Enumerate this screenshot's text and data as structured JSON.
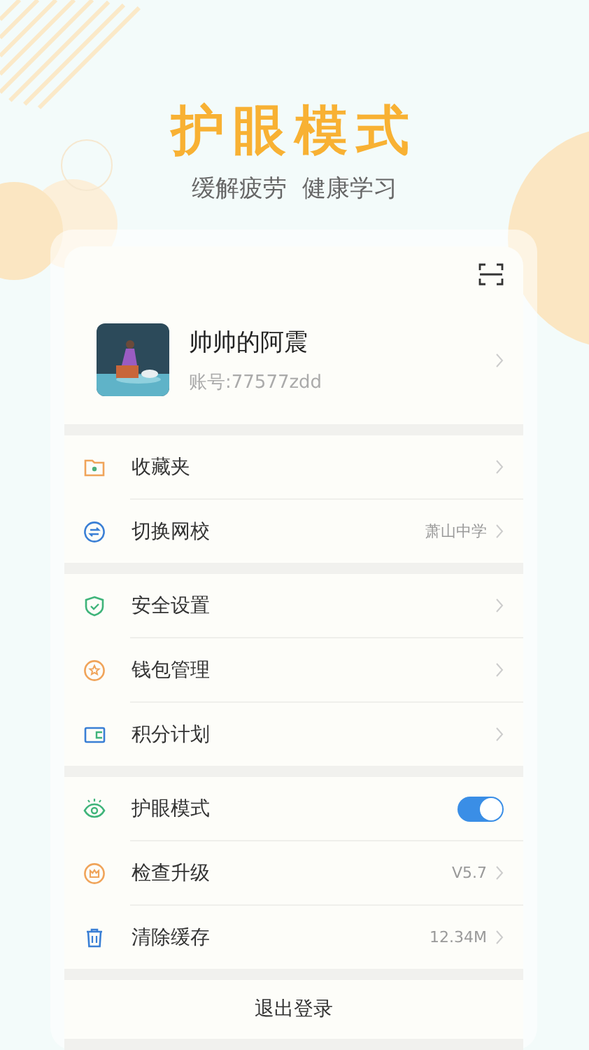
{
  "header": {
    "title": "护眼模式",
    "subtitle": "缓解疲劳  健康学习"
  },
  "profile": {
    "name": "帅帅的阿震",
    "account": "账号:77577zdd"
  },
  "groups": [
    {
      "items": [
        {
          "kind": "link",
          "label": "收藏夹"
        },
        {
          "kind": "link",
          "label": "切换网校",
          "value": "萧山中学"
        }
      ]
    },
    {
      "items": [
        {
          "kind": "link",
          "label": "安全设置"
        },
        {
          "kind": "link",
          "label": "钱包管理"
        },
        {
          "kind": "link",
          "label": "积分计划"
        }
      ]
    },
    {
      "items": [
        {
          "kind": "toggle",
          "label": "护眼模式",
          "on": true
        },
        {
          "kind": "link",
          "label": "检查升级",
          "value": "V5.7"
        },
        {
          "kind": "link",
          "label": "清除缓存",
          "value": "12.34M"
        }
      ]
    }
  ],
  "logout": "退出登录"
}
